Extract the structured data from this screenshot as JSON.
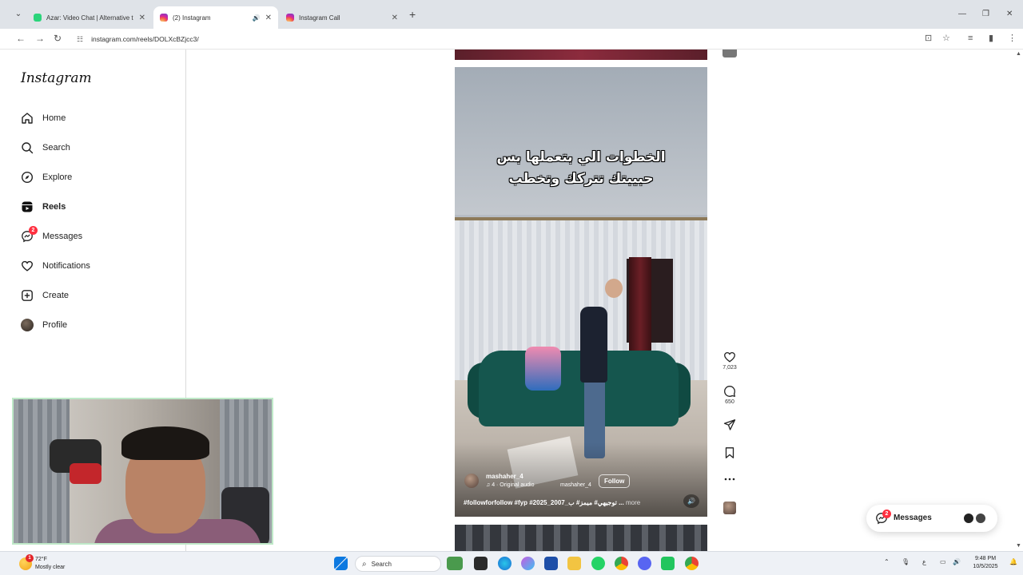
{
  "browser": {
    "tabs": [
      {
        "label": "Azar: Video Chat | Alternative t",
        "active": false,
        "audio": false
      },
      {
        "label": "(2) Instagram",
        "active": true,
        "audio": true
      },
      {
        "label": "Instagram Call",
        "active": false,
        "audio": false
      }
    ],
    "url": "instagram.com/reels/DOLXcBZjcc3/"
  },
  "instagram": {
    "logo": "Instagram",
    "nav": [
      {
        "label": "Home",
        "icon": "home-icon"
      },
      {
        "label": "Search",
        "icon": "search-icon"
      },
      {
        "label": "Explore",
        "icon": "compass-icon"
      },
      {
        "label": "Reels",
        "icon": "reels-icon",
        "active": true
      },
      {
        "label": "Messages",
        "icon": "messenger-icon",
        "badge": "2"
      },
      {
        "label": "Notifications",
        "icon": "heart-icon"
      },
      {
        "label": "Create",
        "icon": "plus-square-icon"
      },
      {
        "label": "Profile",
        "icon": "avatar"
      }
    ],
    "reel": {
      "caption_line1": "الخطوات الي بتعملها بس",
      "caption_line2": "حبيبتك تتركك وتخطب",
      "username": "mashaher_4",
      "audio": "♫ 4 · Original audio",
      "audio_user": "mashaher_4",
      "follow_label": "Follow",
      "tags": "#followforfollow #fyp #2025_2007_توجيهي# ميمز# ب ...",
      "more_label": "more"
    },
    "actions": {
      "likes": "7,023",
      "comments": "650"
    },
    "messages_pill": {
      "label": "Messages",
      "badge": "2"
    }
  },
  "taskbar": {
    "weather_temp": "72°F",
    "weather_cond": "Mostly clear",
    "weather_badge": "1",
    "search_label": "Search",
    "time": "9:48 PM",
    "date": "10/5/2025"
  },
  "colors": {
    "accent_badge": "#ff3040",
    "reel_sofa": "#15564e",
    "webcam_border": "#bfe9c8"
  }
}
